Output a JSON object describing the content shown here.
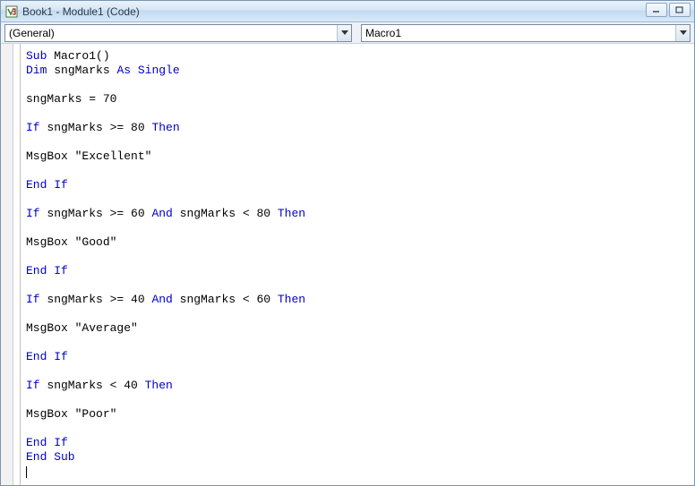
{
  "window": {
    "title": "Book1 - Module1 (Code)"
  },
  "dropdowns": {
    "object": "(General)",
    "procedure": "Macro1"
  },
  "code_tokens": [
    [
      {
        "t": "Sub ",
        "k": true
      },
      {
        "t": "Macro1()",
        "k": false
      }
    ],
    [
      {
        "t": "Dim ",
        "k": true
      },
      {
        "t": "sngMarks ",
        "k": false
      },
      {
        "t": "As Single",
        "k": true
      }
    ],
    [],
    [
      {
        "t": "sngMarks = 70",
        "k": false
      }
    ],
    [],
    [
      {
        "t": "If ",
        "k": true
      },
      {
        "t": "sngMarks >= 80 ",
        "k": false
      },
      {
        "t": "Then",
        "k": true
      }
    ],
    [],
    [
      {
        "t": "MsgBox \"Excellent\"",
        "k": false
      }
    ],
    [],
    [
      {
        "t": "End If",
        "k": true
      }
    ],
    [],
    [
      {
        "t": "If ",
        "k": true
      },
      {
        "t": "sngMarks >= 60 ",
        "k": false
      },
      {
        "t": "And ",
        "k": true
      },
      {
        "t": "sngMarks < 80 ",
        "k": false
      },
      {
        "t": "Then",
        "k": true
      }
    ],
    [],
    [
      {
        "t": "MsgBox \"Good\"",
        "k": false
      }
    ],
    [],
    [
      {
        "t": "End If",
        "k": true
      }
    ],
    [],
    [
      {
        "t": "If ",
        "k": true
      },
      {
        "t": "sngMarks >= 40 ",
        "k": false
      },
      {
        "t": "And ",
        "k": true
      },
      {
        "t": "sngMarks < 60 ",
        "k": false
      },
      {
        "t": "Then",
        "k": true
      }
    ],
    [],
    [
      {
        "t": "MsgBox \"Average\"",
        "k": false
      }
    ],
    [],
    [
      {
        "t": "End If",
        "k": true
      }
    ],
    [],
    [
      {
        "t": "If ",
        "k": true
      },
      {
        "t": "sngMarks < 40 ",
        "k": false
      },
      {
        "t": "Then",
        "k": true
      }
    ],
    [],
    [
      {
        "t": "MsgBox \"Poor\"",
        "k": false
      }
    ],
    [],
    [
      {
        "t": "End If",
        "k": true
      }
    ],
    [
      {
        "t": "End Sub",
        "k": true
      }
    ]
  ]
}
